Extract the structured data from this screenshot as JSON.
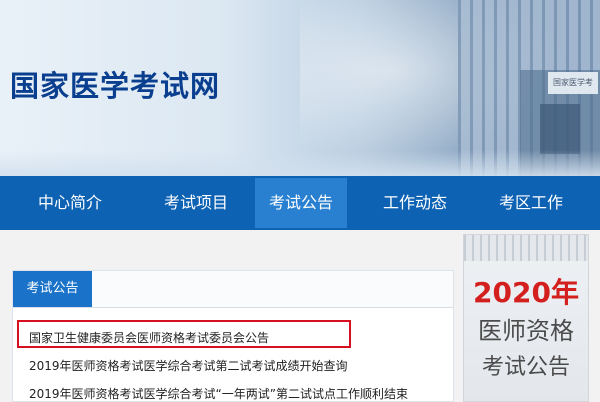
{
  "header": {
    "site_title": "国家医学考试网",
    "building_sign": "国家医学考"
  },
  "nav": {
    "items": [
      {
        "label": "中心简介"
      },
      {
        "label": "考试项目"
      },
      {
        "label": "考试公告"
      },
      {
        "label": "工作动态"
      },
      {
        "label": "考区工作"
      }
    ],
    "active_index": 2
  },
  "content": {
    "tab_label": "考试公告",
    "list": [
      {
        "text": "国家卫生健康委员会医师资格考试委员会公告",
        "highlighted": true
      },
      {
        "text": "2019年医师资格考试医学综合考试第二试考试成绩开始查询"
      },
      {
        "text": "2019年医师资格考试医学综合考试“一年两试”第二试试点工作顺利结束"
      }
    ]
  },
  "promo": {
    "year": "2020年",
    "line1": "医师资格",
    "line2": "考试公告"
  },
  "colors": {
    "nav_bg": "#0d62b4",
    "nav_active": "#2a80d0",
    "title": "#0a3f8f",
    "highlight_border": "#d6101f",
    "promo_year": "#d41f1f"
  }
}
